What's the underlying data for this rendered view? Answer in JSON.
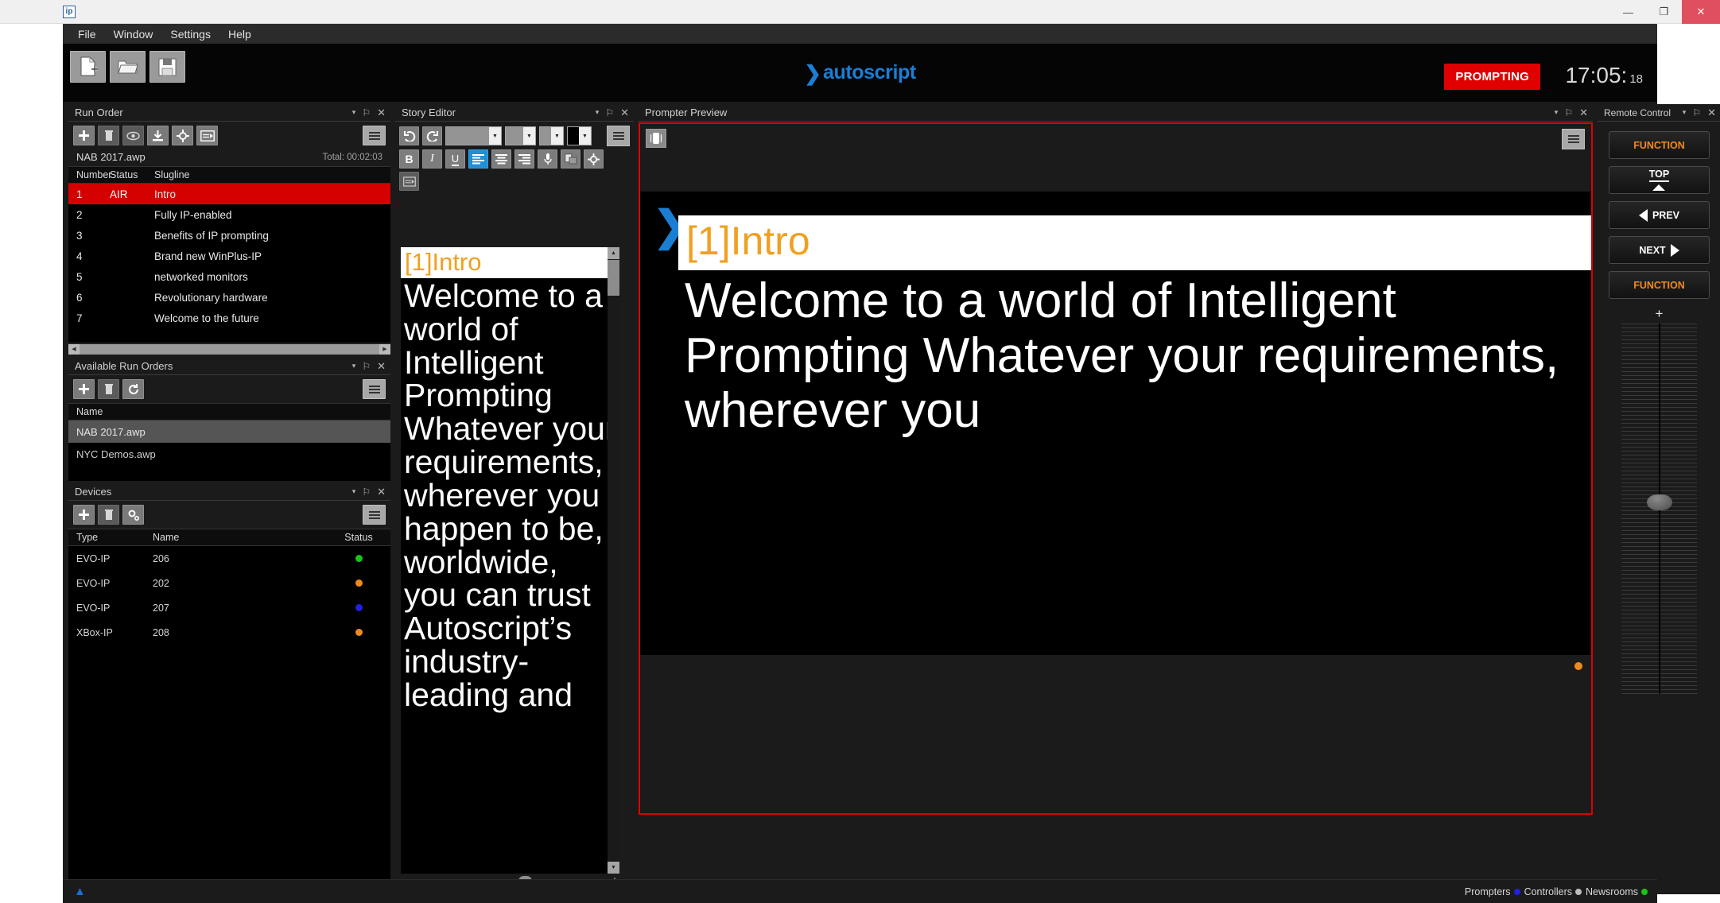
{
  "window": {
    "app_icon_label": "ip",
    "minimize_label": "—",
    "restore_label": "❐",
    "close_label": "✕"
  },
  "menubar": {
    "items": [
      {
        "label": "File"
      },
      {
        "label": "Window"
      },
      {
        "label": "Settings"
      },
      {
        "label": "Help"
      }
    ]
  },
  "header": {
    "toolbar": [
      {
        "name": "new-document-button",
        "icon": "new-document-icon"
      },
      {
        "name": "open-folder-button",
        "icon": "open-folder-icon"
      },
      {
        "name": "save-button",
        "icon": "save-floppy-icon"
      }
    ],
    "brand_chevron": "❯",
    "brand": "autoscript",
    "status_badge": "PROMPTING",
    "clock_time": "17:05:",
    "clock_seconds": "18"
  },
  "run_order": {
    "title": "Run Order",
    "toolbar": [
      {
        "name": "add-story-button",
        "icon": "plus-icon"
      },
      {
        "name": "delete-story-button",
        "icon": "trash-icon"
      },
      {
        "name": "preview-story-button",
        "icon": "eye-icon"
      },
      {
        "name": "import-story-button",
        "icon": "download-icon"
      },
      {
        "name": "locate-story-button",
        "icon": "crosshair-icon"
      },
      {
        "name": "presenter-view-button",
        "icon": "presenter-icon"
      },
      {
        "name": "run-order-menu-button",
        "icon": "hamburger-icon"
      }
    ],
    "file_name": "NAB 2017.awp",
    "total_label": "Total: 00:02:03",
    "columns": [
      "Number",
      "Status",
      "Slugline"
    ],
    "rows": [
      {
        "number": "1",
        "status": "AIR",
        "slugline": "Intro",
        "on_air": true
      },
      {
        "number": "2",
        "status": "",
        "slugline": "Fully IP-enabled",
        "on_air": false
      },
      {
        "number": "3",
        "status": "",
        "slugline": "Benefits of IP prompting",
        "on_air": false
      },
      {
        "number": "4",
        "status": "",
        "slugline": "Brand new WinPlus-IP",
        "on_air": false
      },
      {
        "number": "5",
        "status": "",
        "slugline": "networked monitors",
        "on_air": false
      },
      {
        "number": "6",
        "status": "",
        "slugline": "Revolutionary hardware",
        "on_air": false
      },
      {
        "number": "7",
        "status": "",
        "slugline": "Welcome to the future",
        "on_air": false
      }
    ],
    "zoom_minus": "–",
    "zoom_plus": "+"
  },
  "available_run_orders": {
    "title": "Available Run Orders",
    "toolbar": [
      {
        "name": "add-run-order-button",
        "icon": "plus-icon"
      },
      {
        "name": "delete-run-order-button",
        "icon": "trash-icon"
      },
      {
        "name": "refresh-run-orders-button",
        "icon": "refresh-icon"
      },
      {
        "name": "available-run-orders-menu-button",
        "icon": "hamburger-icon"
      }
    ],
    "columns": [
      "Name"
    ],
    "rows": [
      {
        "name": "NAB 2017.awp",
        "selected": true
      },
      {
        "name": "NYC Demos.awp",
        "selected": false
      }
    ]
  },
  "devices": {
    "title": "Devices",
    "toolbar": [
      {
        "name": "add-device-button",
        "icon": "plus-icon"
      },
      {
        "name": "delete-device-button",
        "icon": "trash-icon"
      },
      {
        "name": "device-settings-button",
        "icon": "gears-icon"
      },
      {
        "name": "devices-menu-button",
        "icon": "hamburger-icon"
      }
    ],
    "columns": [
      "Type",
      "Name",
      "Status"
    ],
    "rows": [
      {
        "type": "EVO-IP",
        "name": "206",
        "status_color": "#19c419"
      },
      {
        "type": "EVO-IP",
        "name": "202",
        "status_color": "#f08a1e"
      },
      {
        "type": "EVO-IP",
        "name": "207",
        "status_color": "#2020e0"
      },
      {
        "type": "XBox-IP",
        "name": "208",
        "status_color": "#f08a1e"
      }
    ]
  },
  "story_editor": {
    "title": "Story Editor",
    "toolbar_row1": [
      {
        "name": "undo-button",
        "icon": "undo-arrow-icon"
      },
      {
        "name": "redo-button",
        "icon": "redo-arrow-icon"
      },
      {
        "name": "font-family-select",
        "icon": "chevron-down-icon",
        "value": ""
      },
      {
        "name": "font-size-select",
        "icon": "chevron-down-icon",
        "value": ""
      },
      {
        "name": "text-color-select",
        "icon": "chevron-down-icon"
      },
      {
        "name": "highlight-color-select",
        "icon": "chevron-down-icon"
      },
      {
        "name": "story-editor-menu-button",
        "icon": "hamburger-icon"
      }
    ],
    "toolbar_row2": [
      {
        "name": "bold-button",
        "label": "B"
      },
      {
        "name": "italic-button",
        "label": "I"
      },
      {
        "name": "underline-button",
        "label": "U"
      },
      {
        "name": "align-left-button",
        "icon": "align-left-icon",
        "active": true
      },
      {
        "name": "align-center-button",
        "icon": "align-center-icon"
      },
      {
        "name": "align-right-button",
        "icon": "align-right-icon"
      },
      {
        "name": "microphone-button",
        "icon": "microphone-icon"
      },
      {
        "name": "insert-cue-button",
        "icon": "insert-cue-icon"
      },
      {
        "name": "marker-button",
        "icon": "crosshair-icon"
      }
    ],
    "toolbar_row3": [
      {
        "name": "presenter-view-button",
        "icon": "presenter-icon"
      }
    ],
    "slug": "[1]Intro",
    "body": "Welcome to a world of Intelligent Prompting Whatever your requirements, wherever you happen to be, worldwide, you can trust Autoscript’s industry-leading and",
    "zoom_minus": "-",
    "zoom_plus": "+"
  },
  "prompter_preview": {
    "title": "Prompter Preview",
    "fullscreen_button": "fullscreen-icon",
    "menu_button": "hamburger-icon",
    "cue_marker": "❯",
    "slug": "[1]Intro",
    "body": "Welcome to a world of Intelligent Prompting Whatever your requirements, wherever you",
    "indicator_color": "#f08a1e",
    "border_color": "#e00000"
  },
  "remote_control": {
    "title": "Remote Control",
    "buttons": [
      {
        "name": "function-top-button",
        "label": "FUNCTION",
        "style": "function"
      },
      {
        "name": "top-button",
        "label": "TOP",
        "style": "top"
      },
      {
        "name": "prev-button",
        "label": "PREV",
        "style": "prev"
      },
      {
        "name": "next-button",
        "label": "NEXT",
        "style": "next"
      },
      {
        "name": "function-bottom-button",
        "label": "FUNCTION",
        "style": "function"
      }
    ],
    "fader_plus": "+"
  },
  "statusbar": {
    "expand_icon": "chevron-up-icon",
    "items": [
      {
        "label": "Prompters",
        "color": "#2020e0"
      },
      {
        "label": "Controllers",
        "color": "#bdbdbd"
      },
      {
        "label": "Newsrooms",
        "color": "#19c419"
      }
    ]
  },
  "panel_controls": {
    "caret": "▾",
    "pin": "⚐",
    "close": "✕"
  }
}
